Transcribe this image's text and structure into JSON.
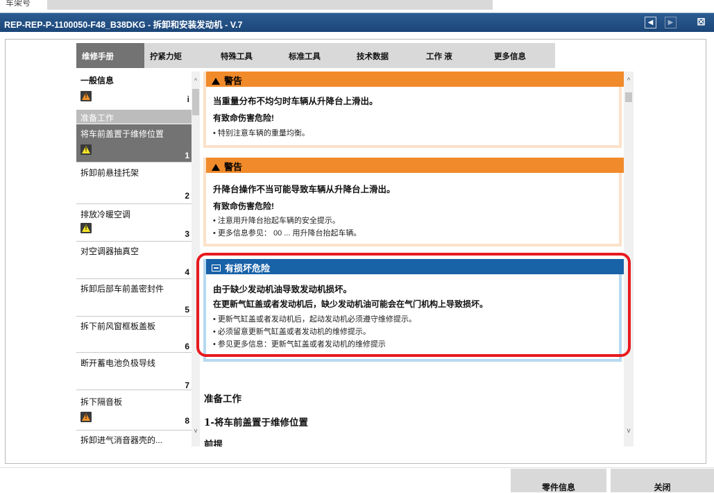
{
  "header": {
    "vin_label": "车架号",
    "vin_value": ""
  },
  "window": {
    "title": "REP-REP-P-1100050-F48_B38DKG - 拆卸和安装发动机 - V.7",
    "prev_icon": "triangle-left-icon",
    "next_icon": "triangle-right-icon",
    "close_icon": "x-icon"
  },
  "tabs": [
    {
      "label": "维修手册",
      "active": true
    },
    {
      "label": "拧紧力矩",
      "active": false
    },
    {
      "label": "特殊工具",
      "active": false
    },
    {
      "label": "标准工具",
      "active": false
    },
    {
      "label": "技术数据",
      "active": false
    },
    {
      "label": "工作 液",
      "active": false
    },
    {
      "label": "更多信息",
      "active": false
    }
  ],
  "sidebar": {
    "general": {
      "label": "一般信息",
      "marker": "i",
      "icon": "warning-orange-icon"
    },
    "prep_header": "准备工作",
    "steps": [
      {
        "label": "将车前盖置于维修位置",
        "num": "1",
        "icon": "warning-yellow-icon"
      },
      {
        "label": "拆卸前悬挂托架",
        "num": "2"
      },
      {
        "label": "排放冷暖空调",
        "num": "3",
        "icon": "warning-yellow-icon"
      },
      {
        "label": "对空调器抽真空",
        "num": "4"
      },
      {
        "label": "拆卸后部车前盖密封件",
        "num": "5"
      },
      {
        "label": "拆下前风窗框板盖板",
        "num": "6"
      },
      {
        "label": "断开蓄电池负极导线",
        "num": "7"
      },
      {
        "label": "拆下隔音板",
        "num": "8",
        "icon": "warning-orange-icon"
      },
      {
        "label": "拆卸进气消音器壳的...",
        "num": ""
      }
    ]
  },
  "content": {
    "warning1": {
      "title": "警告",
      "line1": "当重量分布不均匀时车辆从升降台上滑出。",
      "line2": "有致命伤害危险!",
      "bullets": [
        "• 特别注意车辆的重量均衡。"
      ]
    },
    "warning2": {
      "title": "警告",
      "line1": "升降台操作不当可能导致车辆从升降台上滑出。",
      "line2": "有致命伤害危险!",
      "bullets": [
        "• 注意用升降台抬起车辆的安全提示。",
        "• 更多信息参见： 00 ... 用升降台抬起车辆。"
      ]
    },
    "notice": {
      "title": "有损坏危险",
      "line1": "由于缺少发动机油导致发动机损坏。",
      "line2": "在更新气缸盖或者发动机后，缺少发动机油可能会在气门机构上导致损坏。",
      "bullets": [
        "• 更新气缸盖或者发动机后，起动发动机必须遵守维修提示。",
        "• 必须留意更新气缸盖或者发动机的维修提示。",
        "• 参见更多信息：更新气缸盖或者发动机的维修提示"
      ]
    },
    "section_title": "准备工作",
    "step_title": "1-将车前盖置于维修位置",
    "prereq": "前提"
  },
  "footer": {
    "parts_button": "零件信息",
    "close_button": "关闭"
  },
  "colors": {
    "title_bar": "#1b4679",
    "warning_header": "#f18a2a",
    "notice_header": "#1862a8",
    "highlight": "#e8191e",
    "selected_item": "#737373"
  }
}
